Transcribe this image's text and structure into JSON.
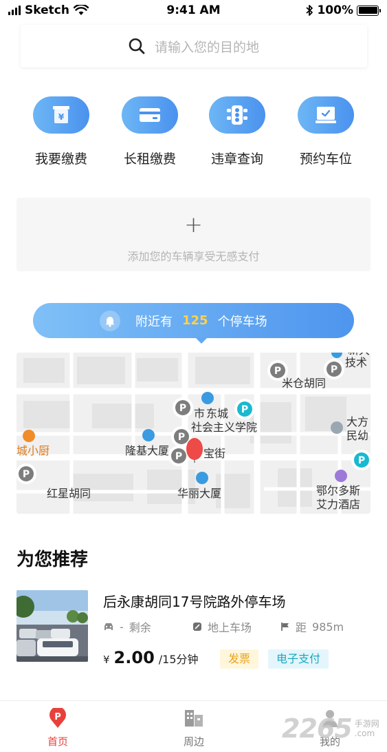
{
  "status_bar": {
    "carrier": "Sketch",
    "time": "9:41 AM",
    "battery": "100%"
  },
  "search": {
    "placeholder": "请输入您的目的地",
    "icon": "search-icon"
  },
  "quick_actions": [
    {
      "label": "我要缴费",
      "icon": "yuan-bill-icon"
    },
    {
      "label": "长租缴费",
      "icon": "card-icon"
    },
    {
      "label": "违章查询",
      "icon": "traffic-light-icon"
    },
    {
      "label": "预约车位",
      "icon": "reserve-check-icon"
    }
  ],
  "add_vehicle": {
    "plus": "+",
    "text": "添加您的车辆享受无感支付"
  },
  "nearby": {
    "prefix": "附近有",
    "count": "125",
    "suffix": "个停车场",
    "icon": "bell-icon"
  },
  "map": {
    "labels": {
      "l1": "东城",
      "l2": "社会主义学院",
      "l3": "市",
      "l4": "隆基大厦",
      "l5": "宝街",
      "l6": "华丽大厦",
      "l7": "红星胡同",
      "l8": "城小厨",
      "l9": "米仓胡同",
      "l10": "大方",
      "l11": "民幼",
      "l12": "鄂尔多斯",
      "l13": "艾力酒店",
      "l14": "技术",
      "l15": "新大"
    },
    "parking_letter": "P",
    "colors": {
      "parking_gray": "#7d7d7d",
      "parking_teal": "#19b9cf",
      "pin_red": "#ee4a47",
      "poi_blue": "#3a9be0",
      "poi_orange": "#f08c2a"
    }
  },
  "recommend": {
    "title": "为您推荐",
    "item": {
      "name": "后永康胡同17号院路外停车场",
      "remaining_label": "剩余",
      "remaining_value": "-",
      "type": "地上车场",
      "distance_prefix": "距",
      "distance": "985m",
      "currency": "¥",
      "price": "2.00",
      "unit": "/15分钟",
      "tags": [
        "发票",
        "电子支付"
      ]
    }
  },
  "tabbar": {
    "tabs": [
      {
        "label": "首页",
        "active": true
      },
      {
        "label": "周边",
        "active": false
      },
      {
        "label": "我的",
        "active": false
      }
    ],
    "active_color": "#e8413c"
  },
  "watermark": {
    "number": "2265",
    "line1": "手游网",
    "line2": ".com"
  }
}
